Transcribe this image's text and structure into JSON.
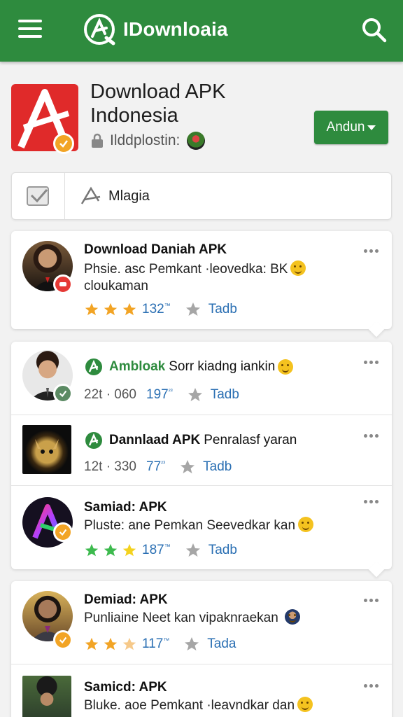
{
  "header": {
    "brand": "IDownloaia",
    "icons": [
      "menu-icon",
      "brand-logo-icon",
      "search-icon"
    ],
    "color": "#2e8b3e"
  },
  "app": {
    "title_line1": "Download APK",
    "title_line2": "Indonesia",
    "meta": "Ilddplostin:",
    "primary_button": "Andun",
    "icon_color": "#e02a2a"
  },
  "filter": {
    "label": "Mlagia"
  },
  "cards": [
    {
      "items": [
        {
          "title": "Download Daniah APK",
          "desc": "Phsie. asc Pemkant ·leovedka: BK",
          "desc2": "cloukaman",
          "rating_stars": 3,
          "star_color": "#f2a425",
          "count": "132",
          "count_sup": "™",
          "tag": "Tadb"
        }
      ]
    },
    {
      "items": [
        {
          "title": "Ambloak",
          "title_rest": "Sorr kiadng iankin",
          "meta": "22t · 060",
          "count": "197",
          "count_sup": "²³",
          "tag": "Tadb"
        },
        {
          "title": "Dannlaad APK",
          "title_rest": "Penralasf yaran",
          "meta": "12t · 330",
          "count": "77",
          "count_sup": "²³",
          "tag": "Tadb"
        },
        {
          "title": "Samiad: APK",
          "desc": "Pluste: ane Pemkan Seevedkar kan",
          "rating_stars": 3,
          "star_color": "#3dba4e",
          "count": "187",
          "count_sup": "™",
          "tag": "Tadb"
        }
      ]
    },
    {
      "items": [
        {
          "title": "Demiad: APK",
          "desc": "Punliaine Neet kan vipaknraekan",
          "rating_stars": 3,
          "star_color": "#f2a425",
          "count": "117",
          "count_sup": "™",
          "tag": "Tada"
        },
        {
          "title": "Samicd: APK",
          "desc": "Bluke. aoe Pemkant ·leavndkar dan"
        }
      ]
    }
  ]
}
